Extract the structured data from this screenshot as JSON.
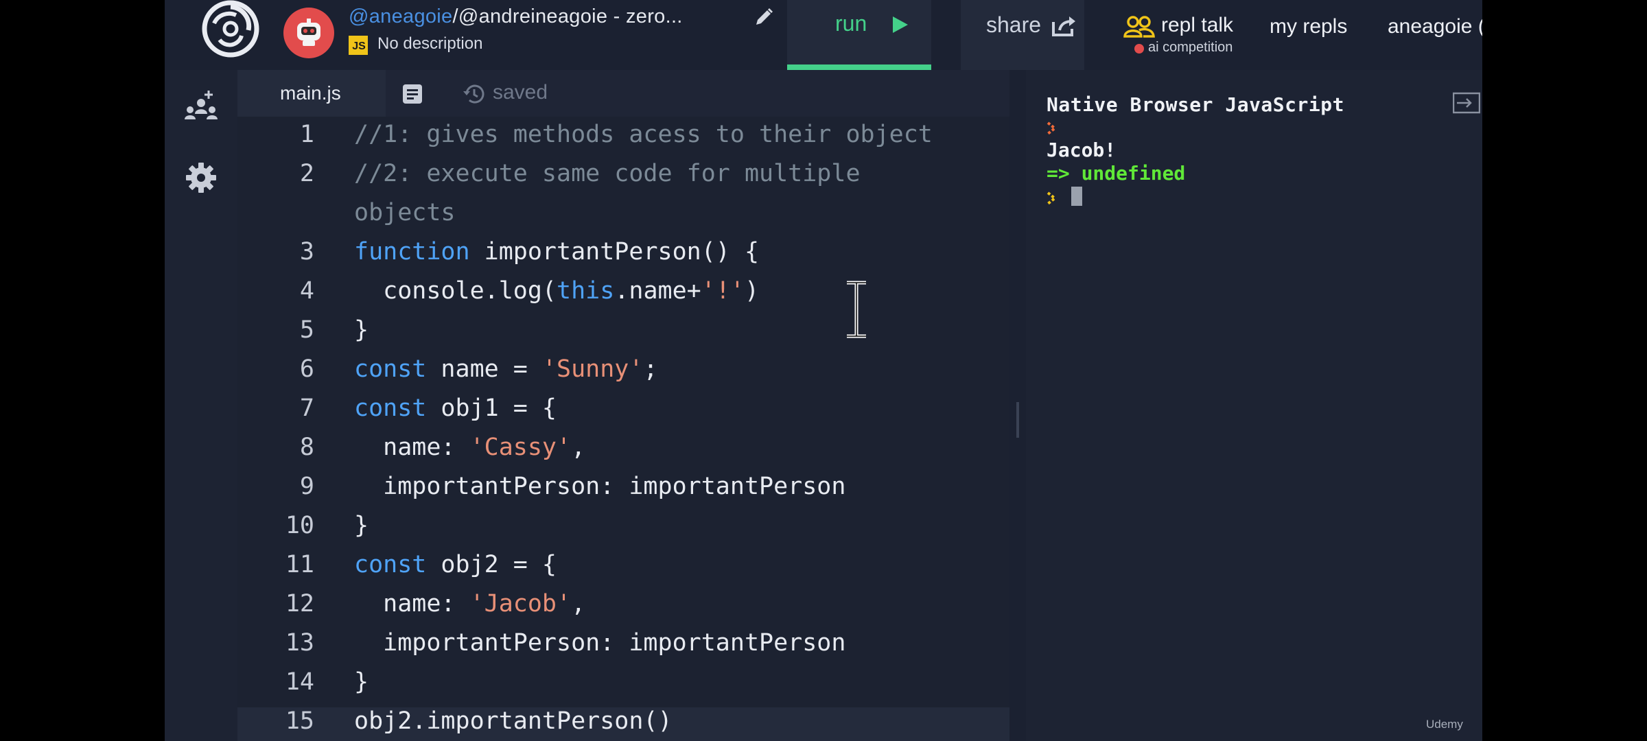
{
  "header": {
    "repl_owner": "@aneagoie",
    "repl_path": "/@andreineagoie - zero...",
    "language_badge": "JS",
    "description": "No description",
    "run_label": "run",
    "share_label": "share",
    "talk_label": "repl talk",
    "talk_sub_label": "ai competition",
    "my_repls_label": "my repls",
    "user_label": "aneagoie ("
  },
  "editor": {
    "tab_label": "main.js",
    "status_label": "saved"
  },
  "code_lines": [
    {
      "n": "1",
      "tokens": [
        [
          "c",
          "//1: gives methods acess to their object"
        ]
      ]
    },
    {
      "n": "2",
      "tokens": [
        [
          "c",
          "//2: execute same code for multiple"
        ]
      ]
    },
    {
      "n": "",
      "tokens": [
        [
          "c",
          "objects"
        ]
      ]
    },
    {
      "n": "3",
      "tokens": [
        [
          "k",
          "function"
        ],
        [
          "t",
          " importantPerson() {"
        ]
      ]
    },
    {
      "n": "4",
      "tokens": [
        [
          "t",
          "  console.log("
        ],
        [
          "k",
          "this"
        ],
        [
          "t",
          ".name+"
        ],
        [
          "s",
          "'!'"
        ],
        [
          "t",
          ")"
        ]
      ]
    },
    {
      "n": "5",
      "tokens": [
        [
          "t",
          "}"
        ]
      ]
    },
    {
      "n": "6",
      "tokens": [
        [
          "k",
          "const"
        ],
        [
          "t",
          " name = "
        ],
        [
          "s",
          "'Sunny'"
        ],
        [
          "t",
          ";"
        ]
      ]
    },
    {
      "n": "7",
      "tokens": [
        [
          "k",
          "const"
        ],
        [
          "t",
          " obj1 = {"
        ]
      ]
    },
    {
      "n": "8",
      "tokens": [
        [
          "t",
          "  name: "
        ],
        [
          "s",
          "'Cassy'"
        ],
        [
          "t",
          ","
        ]
      ]
    },
    {
      "n": "9",
      "tokens": [
        [
          "t",
          "  importantPerson: importantPerson"
        ]
      ]
    },
    {
      "n": "10",
      "tokens": [
        [
          "t",
          "}"
        ]
      ]
    },
    {
      "n": "11",
      "tokens": [
        [
          "k",
          "const"
        ],
        [
          "t",
          " obj2 = {"
        ]
      ]
    },
    {
      "n": "12",
      "tokens": [
        [
          "t",
          "  name: "
        ],
        [
          "s",
          "'Jacob'"
        ],
        [
          "t",
          ","
        ]
      ]
    },
    {
      "n": "13",
      "tokens": [
        [
          "t",
          "  importantPerson: importantPerson"
        ]
      ]
    },
    {
      "n": "14",
      "tokens": [
        [
          "t",
          "}"
        ]
      ]
    },
    {
      "n": "15",
      "tokens": [
        [
          "t",
          "obj2.importantPerson()"
        ]
      ],
      "active": true
    }
  ],
  "console": {
    "title": "Native Browser JavaScript",
    "output_1": "Jacob!",
    "output_2": "=> undefined"
  },
  "watermark": "Udemy",
  "colors": {
    "run_accent": "#44d18a",
    "console_result": "#60e838",
    "keyword": "#4fa3f7",
    "string": "#e89077",
    "comment": "#7c8a97",
    "avatar": "#e24c4c",
    "prompt": "#f26b3a"
  }
}
